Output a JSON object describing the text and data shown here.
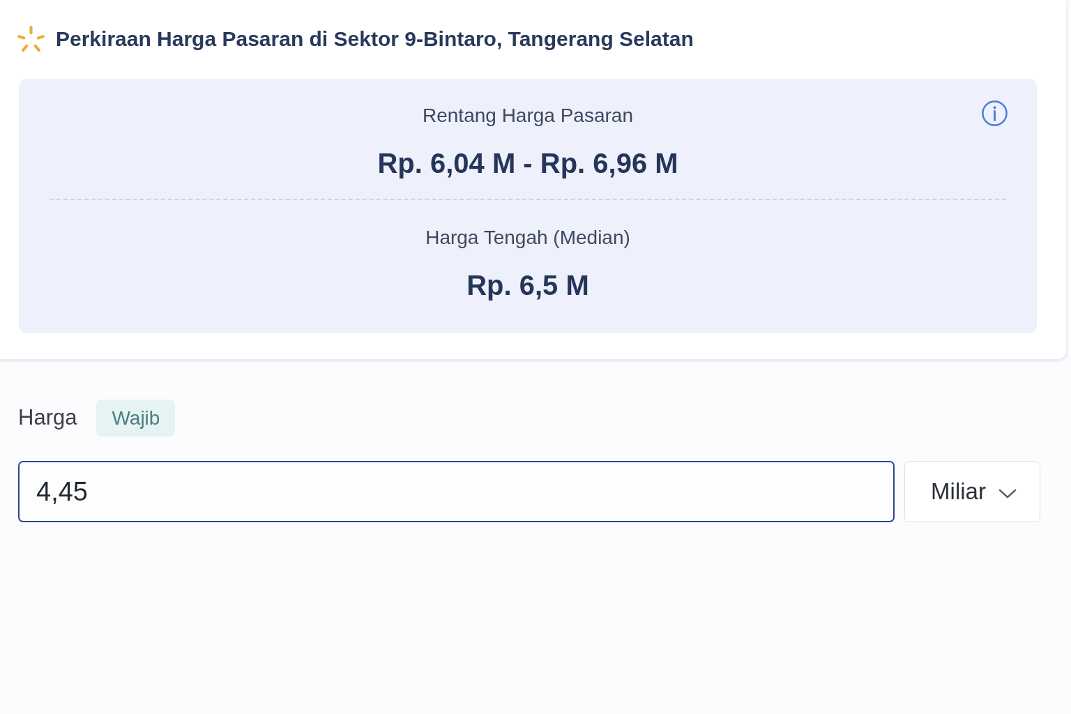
{
  "header": {
    "title": "Perkiraan Harga Pasaran di Sektor 9-Bintaro, Tangerang Selatan"
  },
  "estimate": {
    "sections": [
      {
        "label": "Rentang Harga Pasaran",
        "value": "Rp. 6,04 M - Rp. 6,96 M"
      },
      {
        "label": "Harga Tengah (Median)",
        "value": "Rp. 6,5 M"
      }
    ]
  },
  "price_field": {
    "label": "Harga",
    "badge": "Wajib",
    "value": "4,45",
    "focused": true,
    "unit": "Miliar"
  }
}
